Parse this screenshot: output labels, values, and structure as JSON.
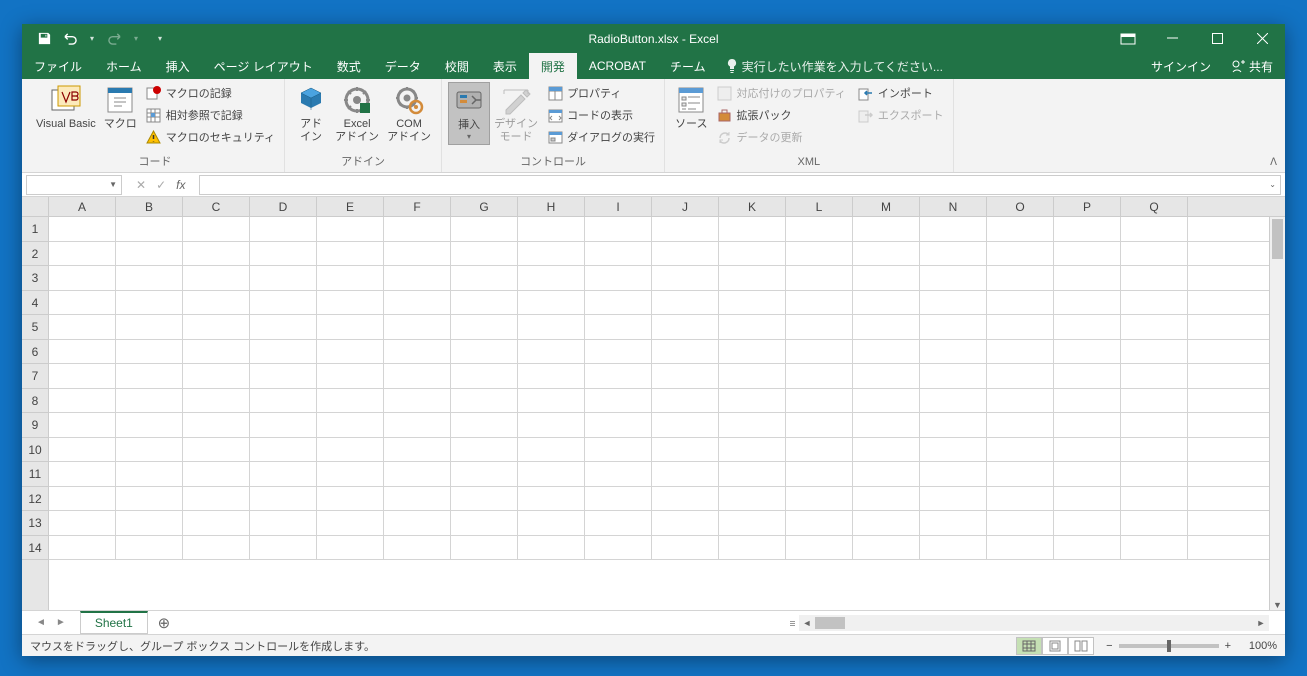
{
  "title": "RadioButton.xlsx - Excel",
  "qat": {
    "save": "save",
    "undo": "undo",
    "redo": "redo"
  },
  "tabs": {
    "file": "ファイル",
    "home": "ホーム",
    "insert": "挿入",
    "pagelayout": "ページ レイアウト",
    "formulas": "数式",
    "data": "データ",
    "review": "校閲",
    "view": "表示",
    "developer": "開発",
    "acrobat": "ACROBAT",
    "team": "チーム"
  },
  "tell_placeholder": "実行したい作業を入力してください...",
  "signin": "サインイン",
  "share": "共有",
  "ribbon": {
    "code": {
      "vb": "Visual Basic",
      "macros": "マクロ",
      "record": "マクロの記録",
      "relative": "相対参照で記録",
      "security": "マクロのセキュリティ",
      "label": "コード"
    },
    "addins": {
      "addin": "アド\nイン",
      "excel": "Excel\nアドイン",
      "com": "COM\nアドイン",
      "label": "アドイン"
    },
    "controls": {
      "insert": "挿入",
      "design": "デザイン\nモード",
      "props": "プロパティ",
      "code": "コードの表示",
      "dialog": "ダイアログの実行",
      "label": "コントロール"
    },
    "xml": {
      "source": "ソース",
      "map": "対応付けのプロパティ",
      "expand": "拡張パック",
      "refresh": "データの更新",
      "import": "インポート",
      "export": "エクスポート",
      "label": "XML"
    }
  },
  "namebox": "",
  "columns": [
    "A",
    "B",
    "C",
    "D",
    "E",
    "F",
    "G",
    "H",
    "I",
    "J",
    "K",
    "L",
    "M",
    "N",
    "O",
    "P",
    "Q"
  ],
  "rows": [
    "1",
    "2",
    "3",
    "4",
    "5",
    "6",
    "7",
    "8",
    "9",
    "10",
    "11",
    "12",
    "13",
    "14"
  ],
  "sheet": "Sheet1",
  "status_msg": "マウスをドラッグし、グループ ボックス コントロールを作成します。",
  "zoom": "100%"
}
